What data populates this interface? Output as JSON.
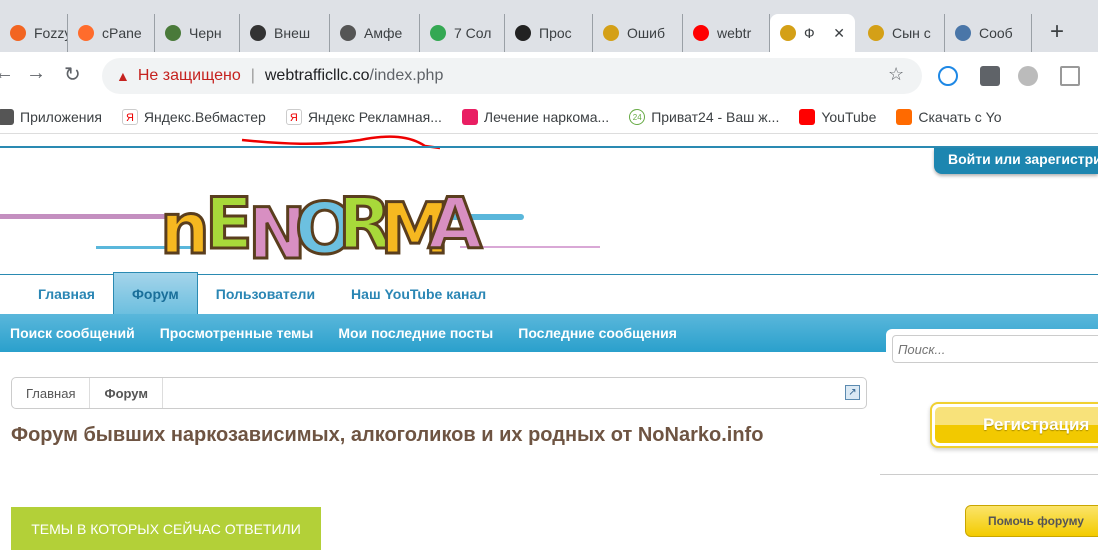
{
  "browser": {
    "tabs": [
      {
        "label": "Fozzy",
        "color": "#f26522"
      },
      {
        "label": "cPane",
        "color": "#ff6c2c"
      },
      {
        "label": "Черн",
        "color": "#4a7a3a"
      },
      {
        "label": "Внеш",
        "color": "#333333"
      },
      {
        "label": "Амфе",
        "color": "#555555"
      },
      {
        "label": "7 Сол",
        "color": "#34a853"
      },
      {
        "label": "Прос",
        "color": "#222222"
      },
      {
        "label": "Ошиб",
        "color": "#d4a017"
      },
      {
        "label": "webtr",
        "color": "#ff0000"
      },
      {
        "label": "Ф",
        "color": "#d4a017",
        "active": true
      },
      {
        "label": "Сын с",
        "color": "#d4a017"
      },
      {
        "label": "Сооб",
        "color": "#4a76a8"
      }
    ],
    "security_label": "Не защищено",
    "url_host": "webtrafficllc.co",
    "url_path": "/index.php",
    "bookmarks": [
      "Приложения",
      "Яндекс.Вебмастер",
      "Яндекс Рекламная...",
      "Лечение наркома...",
      "Приват24 - Ваш ж...",
      "YouTube",
      "Скачать с Yo"
    ]
  },
  "site": {
    "logo_text": "NENORMA",
    "login_label": "Войти или зарегистрироваться",
    "nav": [
      "Главная",
      "Форум",
      "Пользователи",
      "Наш YouTube канал"
    ],
    "subnav": [
      "Поиск сообщений",
      "Просмотренные темы",
      "Мои последние посты",
      "Последние сообщения"
    ],
    "search_placeholder": "Поиск...",
    "breadcrumbs": [
      "Главная",
      "Форум"
    ],
    "title": "Форум бывших наркозависимых, алкоголиков и их родных от NoNarko.info",
    "recent_button": "ТЕМЫ В КОТОРЫХ СЕЙЧАС ОТВЕТИЛИ",
    "register_button": "Регистрация",
    "help_button": "Помочь форуму",
    "accent": "#2aa0cc"
  }
}
